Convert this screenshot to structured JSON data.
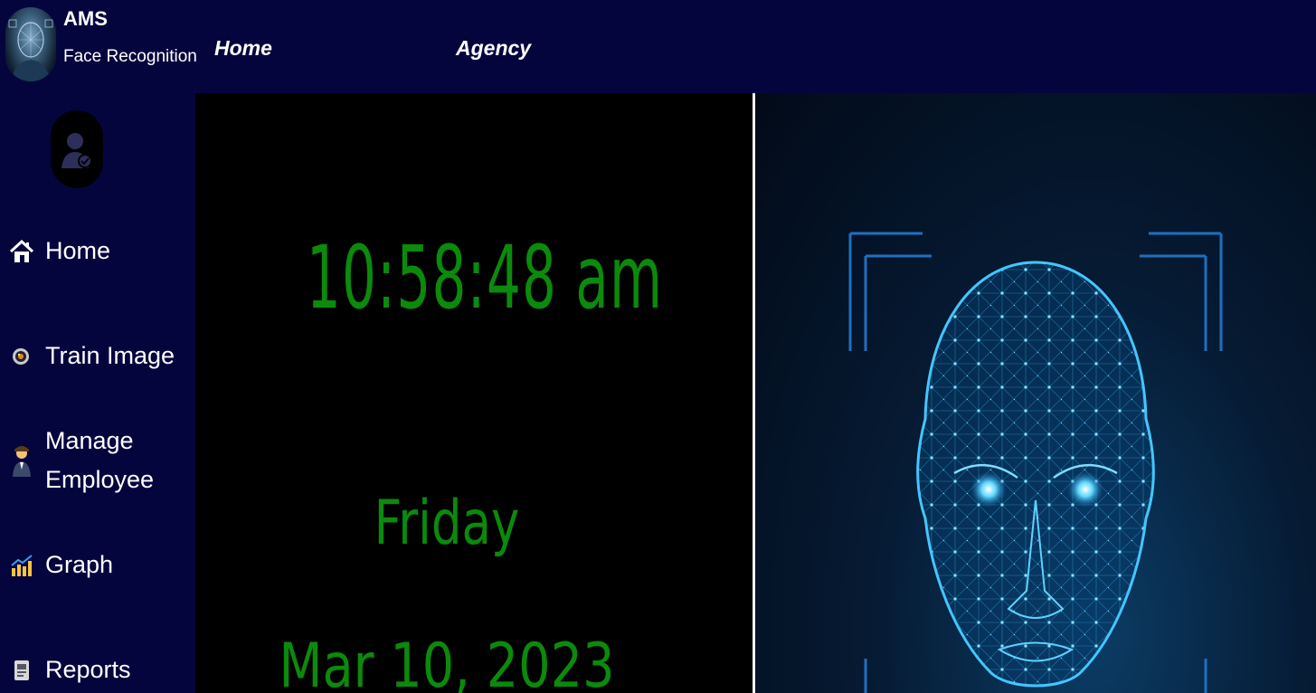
{
  "app": {
    "title": "AMS",
    "subtitle": "Face Recognition"
  },
  "topnav": [
    {
      "label": "Home"
    },
    {
      "label": "Agency"
    }
  ],
  "sidebar": {
    "items": [
      {
        "label": "Home",
        "icon": "home-icon"
      },
      {
        "label": "Train Image",
        "icon": "camera-lens-icon"
      },
      {
        "label": "Manage",
        "label2": "Employee",
        "icon": "employee-icon"
      },
      {
        "label": "Graph",
        "icon": "bar-chart-icon"
      },
      {
        "label": "Reports",
        "icon": "report-icon"
      }
    ]
  },
  "clock": {
    "time": "10:58:48 am",
    "day": "Friday",
    "date": "Mar 10, 2023"
  },
  "colors": {
    "navbar": "#05053e",
    "clock_text": "#0b8a0b",
    "panel_bg": "#000000"
  }
}
